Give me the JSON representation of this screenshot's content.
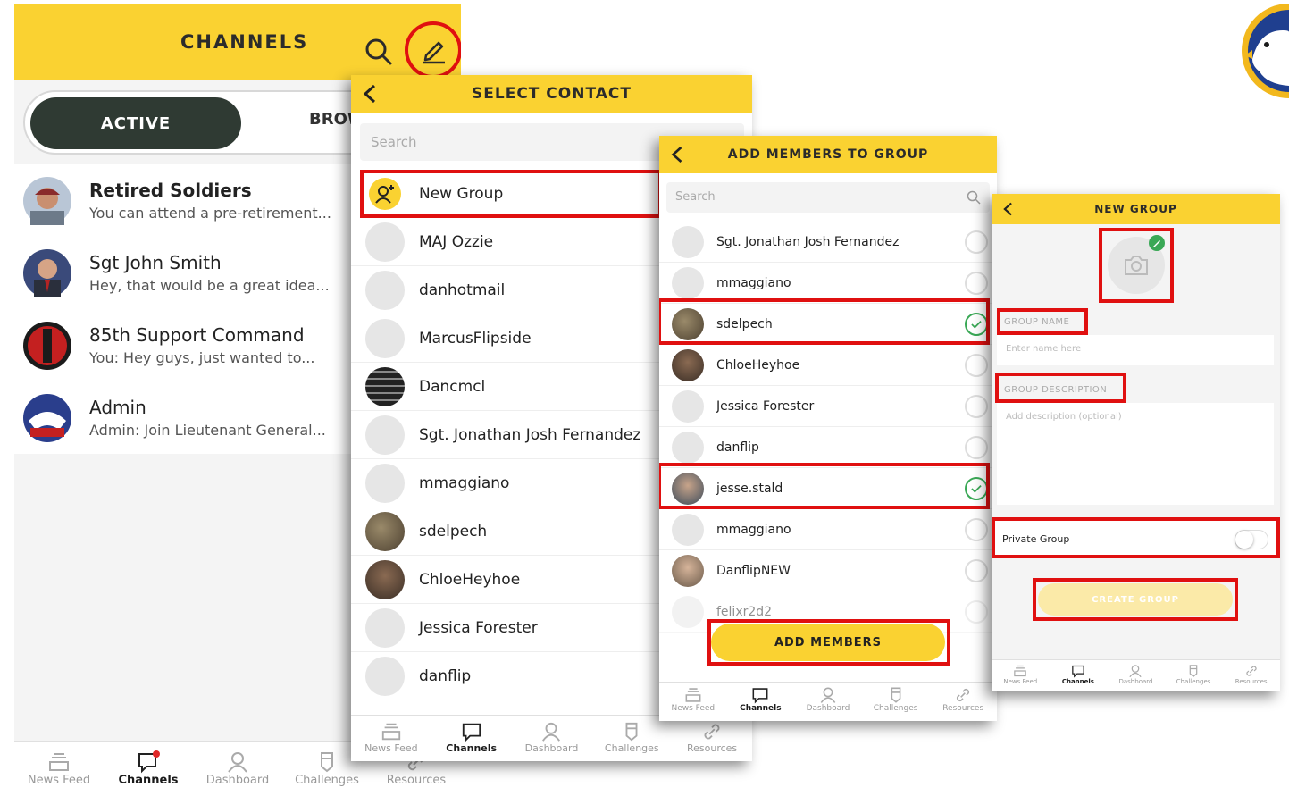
{
  "colors": {
    "accent": "#fad231",
    "highlight": "#e01010",
    "check": "#3aa856",
    "dark_pill": "#2f3a33"
  },
  "panel1": {
    "title": "CHANNELS",
    "tabs": [
      "ACTIVE",
      "BROW"
    ],
    "channels": [
      {
        "name": "Retired Soldiers",
        "preview": "You can attend a pre-retirement..."
      },
      {
        "name": "Sgt John Smith",
        "preview": "Hey, that would be a great idea..."
      },
      {
        "name": "85th Support Command",
        "preview": "You: Hey guys, just wanted to..."
      },
      {
        "name": "Admin",
        "preview": "Admin: Join Lieutenant General..."
      }
    ]
  },
  "nav": {
    "items": [
      "News Feed",
      "Channels",
      "Dashboard",
      "Challenges",
      "Resources"
    ]
  },
  "panel2": {
    "title": "SELECT CONTACT",
    "search_placeholder": "Search",
    "new_group": "New Group",
    "contacts": [
      "MAJ Ozzie",
      "danhotmail",
      "MarcusFlipside",
      "Dancmcl",
      "Sgt. Jonathan Josh Fernandez",
      "mmaggiano",
      "sdelpech",
      "ChloeHeyhoe",
      "Jessica Forester",
      "danflip"
    ]
  },
  "panel3": {
    "title": "ADD MEMBERS TO GROUP",
    "search_placeholder": "Search",
    "members": [
      {
        "name": "Sgt. Jonathan Josh Fernandez",
        "checked": false
      },
      {
        "name": "mmaggiano",
        "checked": false
      },
      {
        "name": "sdelpech",
        "checked": true
      },
      {
        "name": "ChloeHeyhoe",
        "checked": false
      },
      {
        "name": "Jessica Forester",
        "checked": false
      },
      {
        "name": "danflip",
        "checked": false
      },
      {
        "name": "jesse.stald",
        "checked": true
      },
      {
        "name": "mmaggiano",
        "checked": false
      },
      {
        "name": "DanflipNEW",
        "checked": false
      },
      {
        "name": "felixr2d2",
        "checked": false
      }
    ],
    "button": "ADD MEMBERS"
  },
  "panel4": {
    "title": "NEW GROUP",
    "group_name_label": "GROUP NAME",
    "group_name_placeholder": "Enter name here",
    "group_desc_label": "GROUP DESCRIPTION",
    "group_desc_placeholder": "Add description (optional)",
    "private_label": "Private Group",
    "private_on": false,
    "button": "CREATE GROUP"
  }
}
